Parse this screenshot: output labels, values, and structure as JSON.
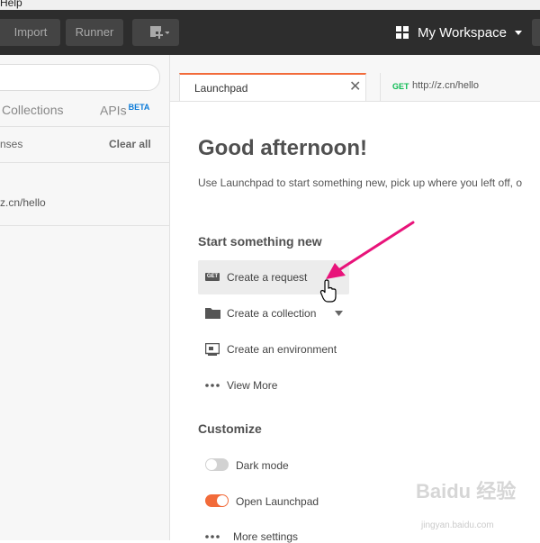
{
  "menubar": {
    "help": "Help"
  },
  "header": {
    "import_label": "Import",
    "runner_label": "Runner",
    "workspace_label": "My Workspace"
  },
  "sidebar": {
    "tabs": [
      {
        "label": "Collections"
      },
      {
        "label": "APIs",
        "badge": "BETA"
      }
    ],
    "history_label": "nses",
    "clear_all_label": "Clear all",
    "history_items": [
      {
        "url": "z.cn/hello"
      }
    ]
  },
  "tabs": [
    {
      "label": "Launchpad",
      "active": true
    },
    {
      "method": "GET",
      "label": "http://z.cn/hello"
    }
  ],
  "main": {
    "greeting": "Good afternoon!",
    "subtitle": "Use Launchpad to start something new, pick up where you left off, o",
    "start_title": "Start something new",
    "actions": [
      {
        "icon": "get-request-icon",
        "badge": "GET",
        "label": "Create a request"
      },
      {
        "icon": "folder-icon",
        "label": "Create a collection"
      },
      {
        "icon": "environment-icon",
        "label": "Create an environment"
      },
      {
        "icon": "ellipsis-icon",
        "label": "View More"
      }
    ],
    "customize_title": "Customize",
    "toggles": [
      {
        "label": "Dark mode",
        "on": false
      },
      {
        "label": "Open Launchpad",
        "on": true
      }
    ],
    "more_settings": "More settings"
  },
  "colors": {
    "header_bg": "#2d2d2d",
    "accent": "#f26b3a",
    "annotation_arrow": "#e8137a"
  },
  "watermark": {
    "text": "Baidu 经验",
    "sub": "jingyan.baidu.com"
  }
}
